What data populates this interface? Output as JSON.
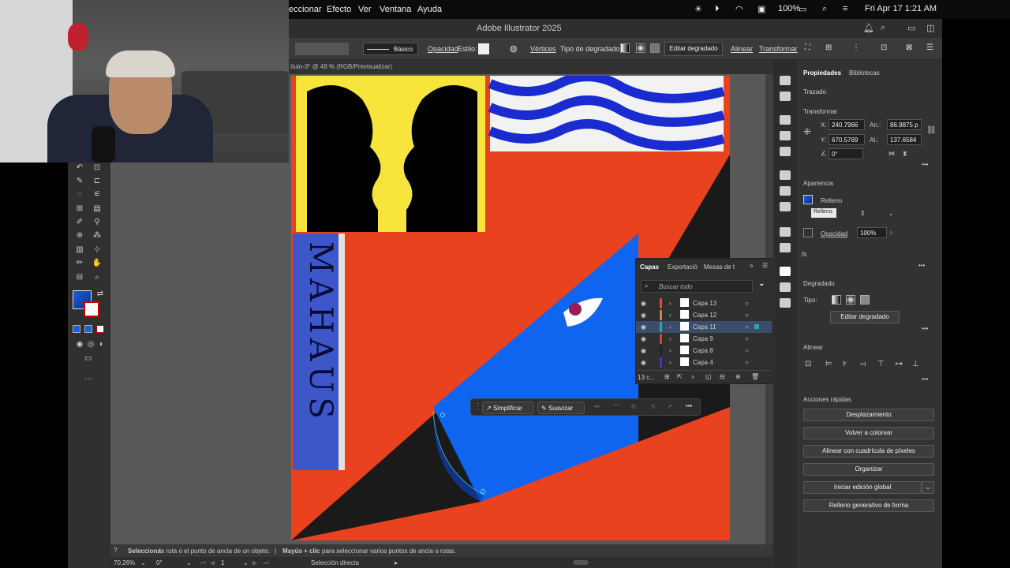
{
  "menubar": {
    "items": [
      "eccionar",
      "Efecto",
      "Ver",
      "Ventana",
      "Ayuda"
    ],
    "battery": "100%",
    "datetime": "Fri Apr 17  1:21 AM"
  },
  "window": {
    "title": "Adobe Illustrator 2025"
  },
  "controlbar": {
    "stroke_style": "Básico",
    "opacity_label": "Opacidad",
    "style_label": "Estilo:",
    "vertices_label": "Vértices",
    "gradient_type_label": "Tipo de degradado:",
    "edit_gradient_button": "Editar degradado",
    "align_link": "Alinear",
    "transform_link": "Transformar"
  },
  "doc_tab": {
    "label": "ítulo-3* @ 49 % (RGB/Previsualizar)"
  },
  "artwork": {
    "poster_text": "MAHAUS"
  },
  "properties": {
    "tab_properties": "Propiedades",
    "tab_libraries": "Bibliotecas",
    "object_type": "Trazado",
    "transform_title": "Transformar",
    "x_label": "X:",
    "x_value": "240.7966",
    "y_label": "Y:",
    "y_value": "670.5769",
    "w_label": "An.:",
    "w_value": "86.9875 p",
    "h_label": "Al.:",
    "h_value": "137.6584",
    "angle_value": "0°",
    "appearance_title": "Apariencia",
    "fill_label": "Relleno",
    "fill_tooltip": "Relleno",
    "opacity_label": "Opacidad",
    "opacity_value": "100%",
    "fx_label": "fx.",
    "gradient_title": "Degradado",
    "gradient_type_label": "Tipo:",
    "edit_gradient_button": "Editar degradado",
    "align_title": "Alinear",
    "quick_actions_title": "Acciones rápidas",
    "quick_actions": [
      "Desplazamiento",
      "Volver a colorear",
      "Alinear con cuadrícula de píxeles",
      "Organizar",
      "Iniciar edición global",
      "Relleno generativo de forma"
    ]
  },
  "layers_panel": {
    "tabs": [
      "Capas",
      "Exportació",
      "Mesas de t"
    ],
    "search_placeholder": "Buscar todo",
    "layers": [
      {
        "name": "Capa 13",
        "color": "#e34b2f"
      },
      {
        "name": "Capa 12",
        "color": "#c38c3a"
      },
      {
        "name": "Capa 11",
        "color": "#2aa9a0"
      },
      {
        "name": "Capa 9",
        "color": "#e3392f"
      },
      {
        "name": "Capa 8",
        "color": "#222222"
      },
      {
        "name": "Capa 4",
        "color": "#3a3ad4"
      }
    ],
    "count_label": "13 c..."
  },
  "context_bar": {
    "simplify_label": "Simplificar",
    "smooth_label": "Suavizar"
  },
  "statusbar": {
    "hint_bold1": "Selecciona",
    "hint_text1": "la ruta o el punto de ancla de un objeto.",
    "hint_sep": "|",
    "hint_bold2": "Mayús + clic",
    "hint_text2": "para seleccionar varios puntos de ancla o rutas."
  },
  "bottombar": {
    "zoom": "70.26%",
    "angle": "0°",
    "artboard_num": "1",
    "tool_name": "Selección directa"
  },
  "colors": {
    "poster_red": "#e8421f",
    "poster_blue": "#0f65f0",
    "poster_yellow": "#f7e53c",
    "poster_dark": "#1a1a1a"
  }
}
